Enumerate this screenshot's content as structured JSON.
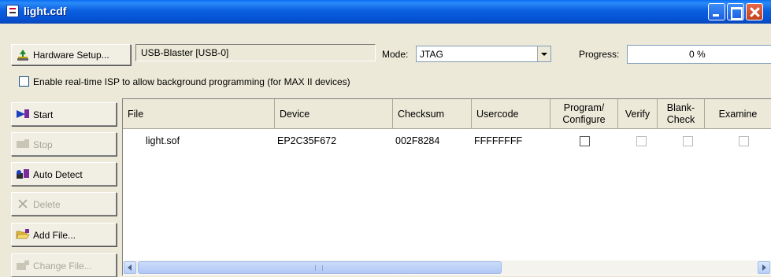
{
  "window": {
    "title": "light.cdf"
  },
  "toolbar": {
    "hardware_setup_label": "Hardware Setup...",
    "hardware_value": "USB-Blaster [USB-0]",
    "mode_label": "Mode:",
    "mode_value": "JTAG",
    "progress_label": "Progress:",
    "progress_value": "0 %",
    "progress_fraction": 0
  },
  "isp": {
    "label": "Enable real-time ISP to allow background programming (for MAX II devices)",
    "checked": false
  },
  "side_buttons": [
    {
      "label": "Start",
      "enabled": true,
      "icon": "start-icon"
    },
    {
      "label": "Stop",
      "enabled": false,
      "icon": "stop-icon"
    },
    {
      "label": "Auto Detect",
      "enabled": true,
      "icon": "auto-detect-icon"
    },
    {
      "label": "Delete",
      "enabled": false,
      "icon": "delete-icon"
    },
    {
      "label": "Add File...",
      "enabled": true,
      "icon": "folder-open-icon"
    },
    {
      "label": "Change File...",
      "enabled": false,
      "icon": "change-file-icon"
    }
  ],
  "table": {
    "columns": [
      "File",
      "Device",
      "Checksum",
      "Usercode",
      "Program/ Configure",
      "Verify",
      "Blank- Check",
      "Examine"
    ],
    "rows": [
      {
        "file": "light.sof",
        "device": "EP2C35F672",
        "checksum": "002F8284",
        "usercode": "FFFFFFFF",
        "program_configure": false,
        "verify": false,
        "blank_check": false,
        "examine": false
      }
    ]
  }
}
